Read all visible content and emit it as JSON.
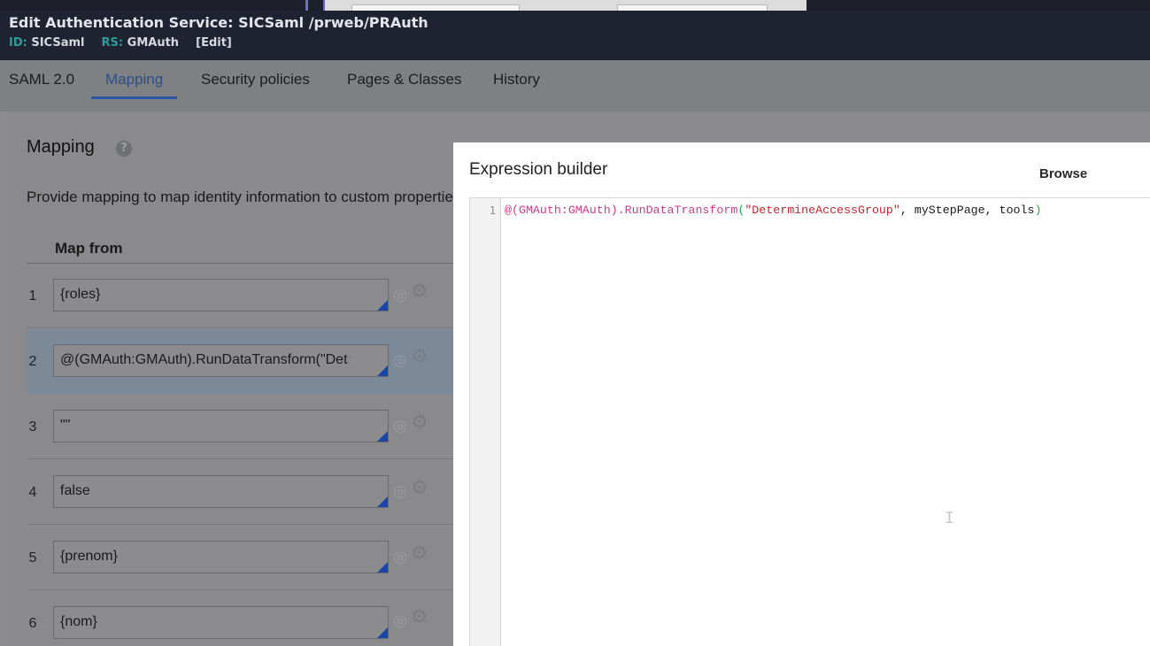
{
  "header": {
    "title": "Edit  Authentication Service: SICSaml /prweb/PRAuth",
    "id_label": "ID:",
    "id_value": "SICSaml",
    "rs_label": "RS:",
    "rs_value": "GMAuth",
    "edit_link": "[Edit]"
  },
  "tabs": [
    {
      "label": "SAML 2.0",
      "active": false
    },
    {
      "label": "Mapping",
      "active": true
    },
    {
      "label": "Security policies",
      "active": false
    },
    {
      "label": "Pages & Classes",
      "active": false
    },
    {
      "label": "History",
      "active": false
    }
  ],
  "mapping": {
    "title": "Mapping",
    "help_icon": "question-circle-icon",
    "description": "Provide mapping to map identity information to custom properties",
    "column_header": "Map from",
    "rows": [
      {
        "num": "1",
        "value": "{roles}",
        "selected": false
      },
      {
        "num": "2",
        "value": "@(GMAuth:GMAuth).RunDataTransform(\"Det",
        "selected": true
      },
      {
        "num": "3",
        "value": "\"\"",
        "selected": false
      },
      {
        "num": "4",
        "value": "false",
        "selected": false
      },
      {
        "num": "5",
        "value": "{prenom}",
        "selected": false
      },
      {
        "num": "6",
        "value": "{nom}",
        "selected": false
      }
    ],
    "row_icons": [
      "target-icon",
      "gear-icon"
    ]
  },
  "expression_builder": {
    "title": "Expression builder",
    "browse_label": "Browse",
    "line_number": "1",
    "code": {
      "fn": "@(GMAuth:GMAuth).RunDataTransform",
      "open_paren": "(",
      "string_arg": "\"DetermineAccessGroup\"",
      "rest": ", myStepPage, tools",
      "close_paren": ")"
    }
  },
  "colors": {
    "header_bg": "#1f2230",
    "id_label": "#2f9b9a",
    "active_tab": "#2b56a3",
    "token_function": "#d23a8a",
    "token_string": "#c2272d",
    "token_paren": "#28a845"
  }
}
